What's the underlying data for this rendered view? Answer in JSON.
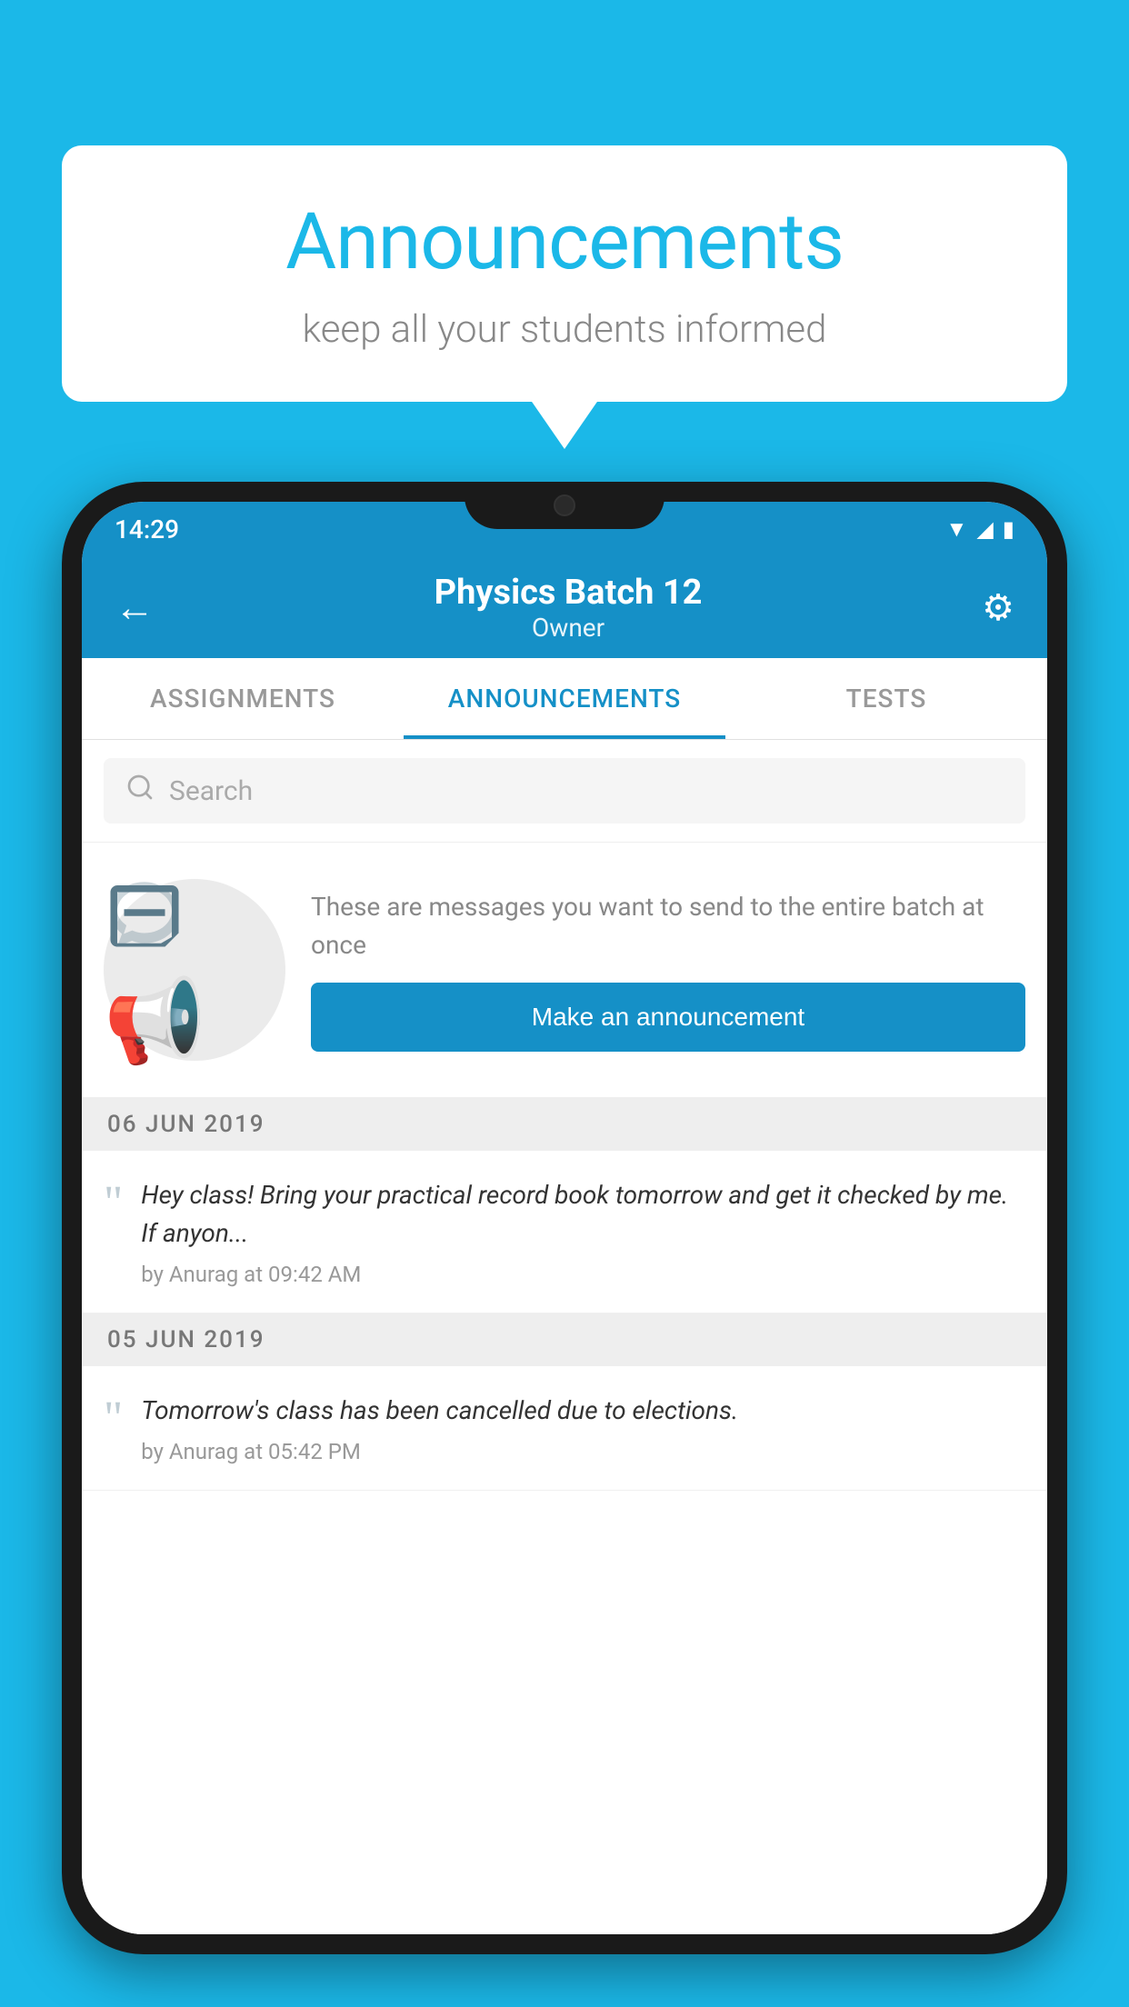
{
  "background_color": "#1BB8E8",
  "speech_bubble": {
    "title": "Announcements",
    "subtitle": "keep all your students informed"
  },
  "status_bar": {
    "time": "14:29",
    "icons": [
      "wifi",
      "signal",
      "battery"
    ]
  },
  "app_bar": {
    "back_label": "←",
    "title": "Physics Batch 12",
    "subtitle": "Owner",
    "settings_label": "⚙"
  },
  "tabs": [
    {
      "label": "ASSIGNMENTS",
      "active": false
    },
    {
      "label": "ANNOUNCEMENTS",
      "active": true
    },
    {
      "label": "TESTS",
      "active": false
    },
    {
      "label": "...",
      "active": false
    }
  ],
  "search": {
    "placeholder": "Search"
  },
  "promo": {
    "description": "These are messages you want to send to the entire batch at once",
    "button_label": "Make an announcement"
  },
  "announcements": [
    {
      "date": "06  JUN  2019",
      "items": [
        {
          "text": "Hey class! Bring your practical record book tomorrow and get it checked by me. If anyon...",
          "meta": "by Anurag at 09:42 AM"
        }
      ]
    },
    {
      "date": "05  JUN  2019",
      "items": [
        {
          "text": "Tomorrow's class has been cancelled due to elections.",
          "meta": "by Anurag at 05:42 PM"
        }
      ]
    }
  ]
}
